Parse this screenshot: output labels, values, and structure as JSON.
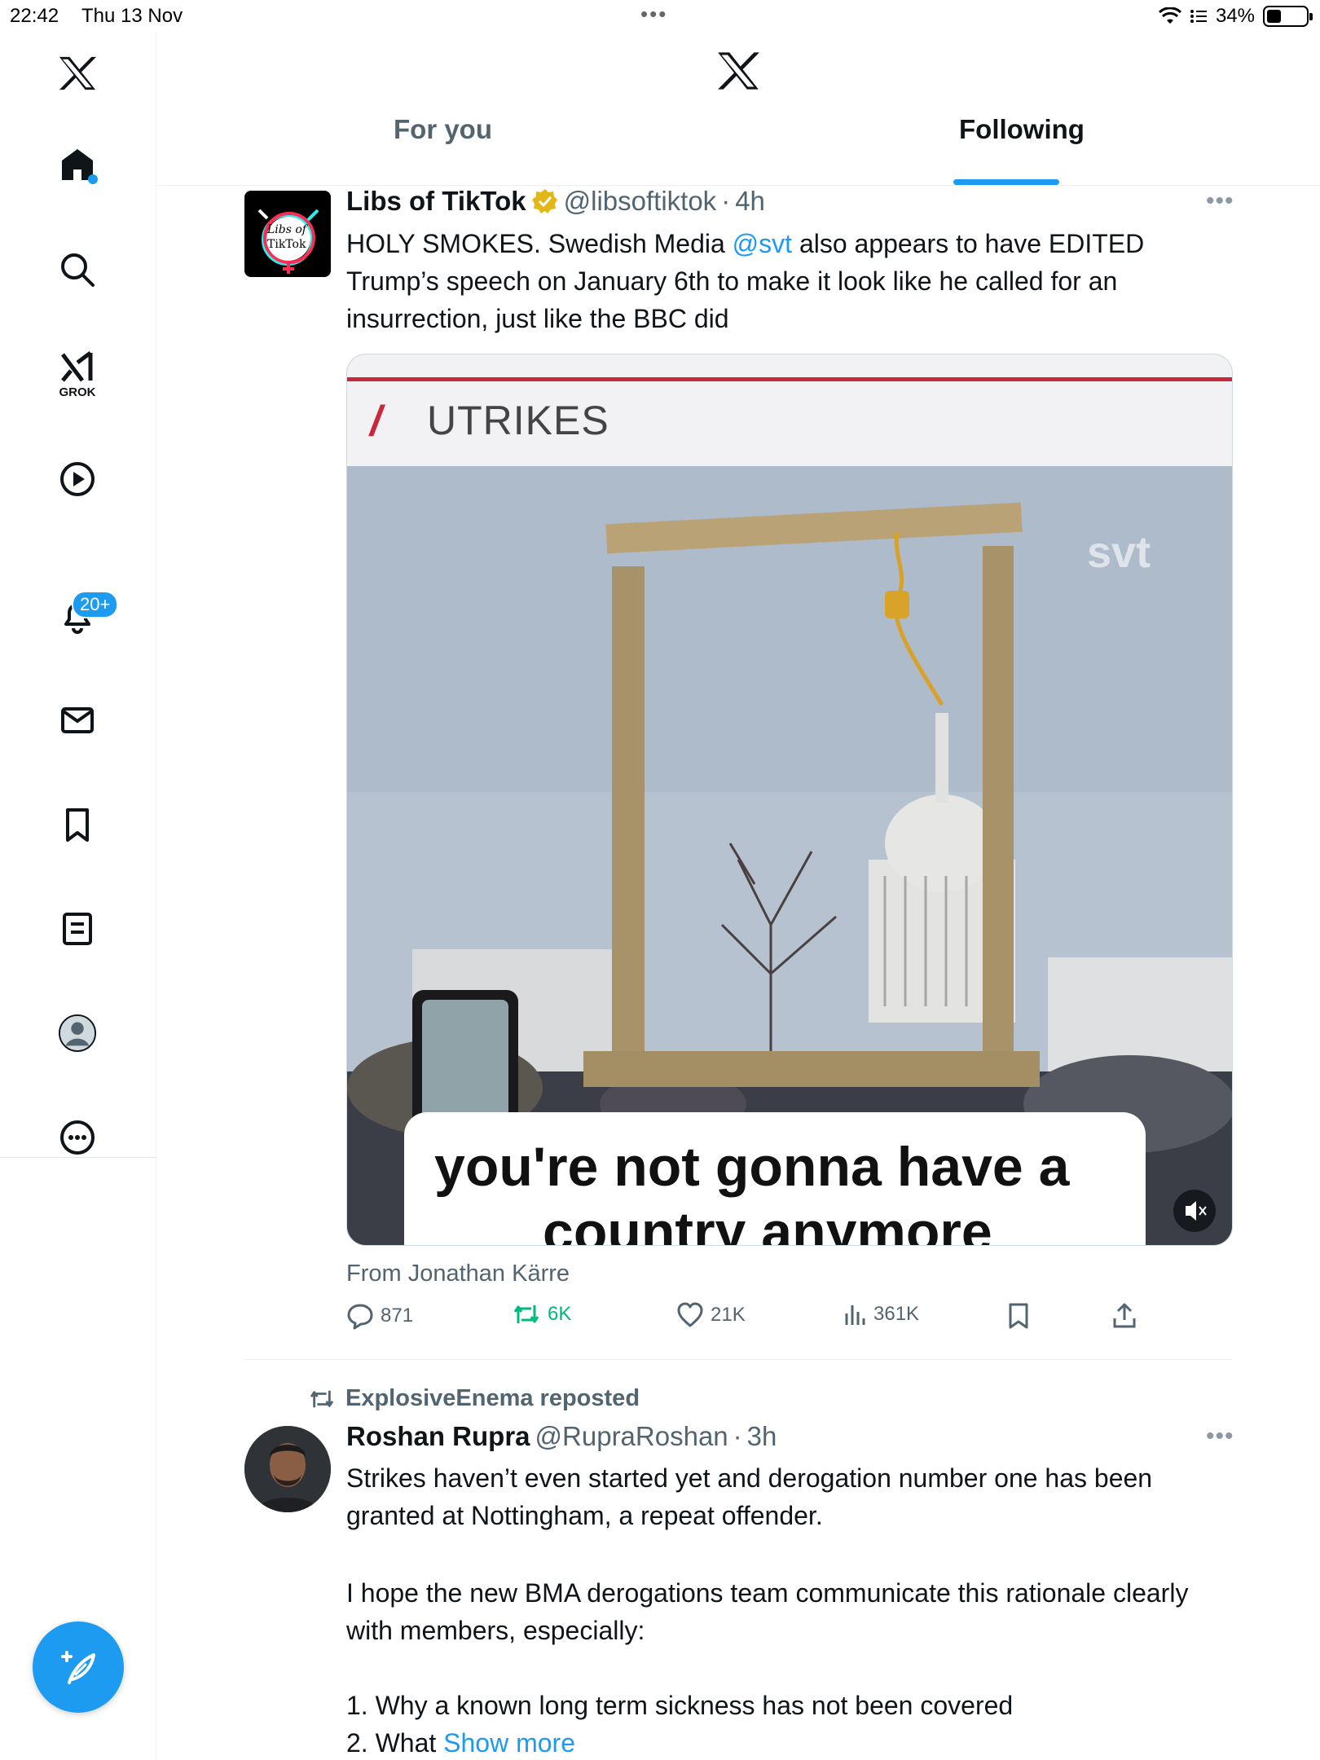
{
  "status_bar": {
    "time": "22:42",
    "date": "Thu 13 Nov",
    "battery": "34%"
  },
  "sidebar": {
    "grok_label": "GROK",
    "notifications_badge": "20+"
  },
  "header": {
    "tabs": [
      {
        "label": "For you",
        "active": false
      },
      {
        "label": "Following",
        "active": true
      }
    ]
  },
  "post1": {
    "display_name": "Libs of TikTok",
    "avatar_text_1": "Libs of",
    "avatar_text_2": "TikTok",
    "handle": "@libsoftiktok",
    "separator": "·",
    "time": "4h",
    "text_before_mention": "HOLY SMOKES. Swedish Media ",
    "mention": "@svt",
    "text_after_mention": " also appears to have EDITED Trump’s speech on January 6th to make it look like he called for an insurrection, just like the BBC did",
    "media": {
      "banner_title": "UTRIKES",
      "watermark": "svt",
      "caption_line1": "you're not gonna have a",
      "caption_line2": "country anymore"
    },
    "from": "From Jonathan Kärre",
    "stats": {
      "replies": "871",
      "reposts": "6K",
      "likes": "21K",
      "views": "361K"
    }
  },
  "post2": {
    "repost_label": "ExplosiveEnema reposted",
    "display_name": "Roshan Rupra",
    "handle": "@RupraRoshan",
    "separator": "·",
    "time": "3h",
    "para1": "Strikes haven’t even started yet and derogation number one has been granted at Nottingham, a repeat offender.",
    "para2": "I hope the new BMA derogations team communicate this rationale clearly with members, especially:",
    "item1": "1. Why a known long term sickness has not been covered",
    "item2": "2. What",
    "show_more": "Show more"
  },
  "colors": {
    "accent": "#1d9bf0",
    "repost_green": "#00ba7c",
    "secondary_text": "#536471"
  }
}
